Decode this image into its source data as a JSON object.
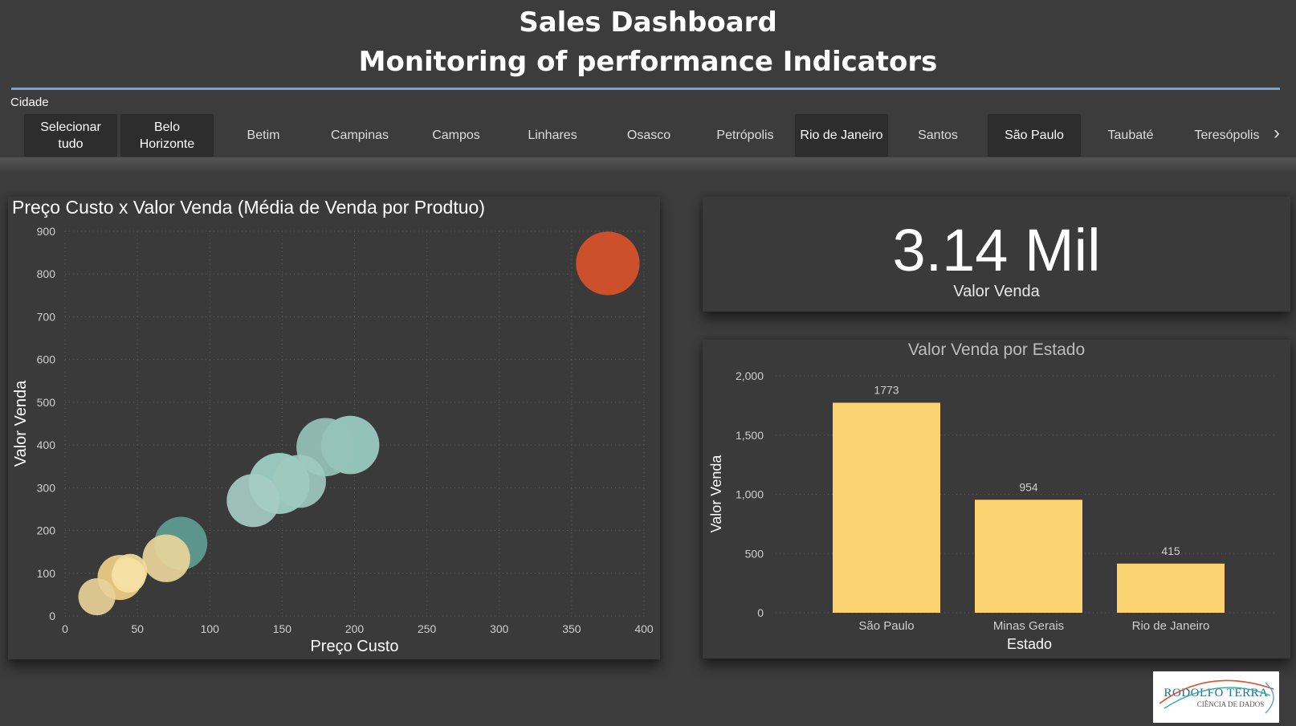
{
  "header": {
    "title_line1": "Sales Dashboard",
    "title_line2": "Monitoring of performance Indicators",
    "rule_color": "#6fa8d6"
  },
  "slicer": {
    "label": "Cidade",
    "items": [
      {
        "label": "Selecionar tudo",
        "selected": true
      },
      {
        "label": "Belo Horizonte",
        "selected": true
      },
      {
        "label": "Betim",
        "selected": false
      },
      {
        "label": "Campinas",
        "selected": false
      },
      {
        "label": "Campos",
        "selected": false
      },
      {
        "label": "Linhares",
        "selected": false
      },
      {
        "label": "Osasco",
        "selected": false
      },
      {
        "label": "Petrópolis",
        "selected": false
      },
      {
        "label": "Rio de Janeiro",
        "selected": true
      },
      {
        "label": "Santos",
        "selected": false
      },
      {
        "label": "São Paulo",
        "selected": true
      },
      {
        "label": "Taubaté",
        "selected": false
      },
      {
        "label": "Teresópolis",
        "selected": false
      }
    ],
    "next_icon": "chevron-right-icon"
  },
  "kpi": {
    "value": "3.14 Mil",
    "label": "Valor Venda"
  },
  "chart_data": [
    {
      "type": "scatter",
      "title": "Preço Custo x Valor Venda (Média de Venda por Prodtuo)",
      "xlabel": "Preço Custo",
      "ylabel": "Valor Venda",
      "xlim": [
        0,
        400
      ],
      "ylim": [
        0,
        900
      ],
      "xticks": [
        0,
        50,
        100,
        150,
        200,
        250,
        300,
        350,
        400
      ],
      "yticks": [
        0,
        100,
        200,
        300,
        400,
        500,
        600,
        700,
        800,
        900
      ],
      "grid": true,
      "points": [
        {
          "x": 375,
          "y": 825,
          "size": 1.2,
          "color": "#d9532b"
        },
        {
          "x": 197,
          "y": 400,
          "size": 1.1,
          "color": "#9bcfc3"
        },
        {
          "x": 180,
          "y": 395,
          "size": 1.1,
          "color": "#96c3b8"
        },
        {
          "x": 148,
          "y": 310,
          "size": 1.15,
          "color": "#9fd4c6"
        },
        {
          "x": 162,
          "y": 315,
          "size": 1.0,
          "color": "#9ec9bd"
        },
        {
          "x": 130,
          "y": 270,
          "size": 1.0,
          "color": "#a5ccc3"
        },
        {
          "x": 80,
          "y": 170,
          "size": 1.0,
          "color": "#5e9d92"
        },
        {
          "x": 70,
          "y": 135,
          "size": 0.9,
          "color": "#e9d59a"
        },
        {
          "x": 38,
          "y": 90,
          "size": 0.85,
          "color": "#efcf86"
        },
        {
          "x": 45,
          "y": 105,
          "size": 0.65,
          "color": "#f2dc9c"
        },
        {
          "x": 44,
          "y": 95,
          "size": 0.65,
          "color": "#f7e1a4"
        },
        {
          "x": 22,
          "y": 45,
          "size": 0.7,
          "color": "#e8d199"
        }
      ]
    },
    {
      "type": "bar",
      "title": "Valor Venda por Estado",
      "xlabel": "Estado",
      "ylabel": "Valor Venda",
      "categories": [
        "São Paulo",
        "Minas Gerais",
        "Rio de Janeiro"
      ],
      "values": [
        1773,
        954,
        415
      ],
      "data_labels": [
        "1773",
        "954",
        "415"
      ],
      "ylim": [
        0,
        2000
      ],
      "yticks": [
        0,
        500,
        1000,
        1500,
        2000
      ],
      "ytick_labels": [
        "0",
        "500",
        "1,000",
        "1,500",
        "2,000"
      ],
      "grid": true,
      "bar_color": "#fbd471"
    }
  ],
  "logo": {
    "name": "RODOLFO TERRA",
    "sub": "CIÊNCIA DE DADOS"
  }
}
